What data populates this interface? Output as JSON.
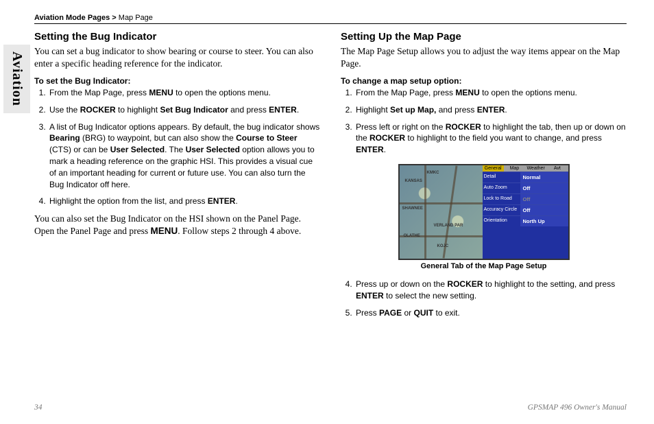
{
  "tab": "Aviation",
  "breadcrumb": {
    "category": "Aviation Mode Pages >",
    "page": " Map Page"
  },
  "left": {
    "heading": "Setting the Bug Indicator",
    "intro": "You can set a bug indicator to show bearing or course to steer. You can also enter a specific heading reference for the indicator.",
    "subhead": "To set the Bug Indicator:",
    "steps": [
      "From the Map Page, press <b class='k'>MENU</b> to open the options menu.",
      "Use the <b class='k'>ROCKER</b> to highlight <b class='k'>Set Bug Indicator</b> and press <b class='k'>ENTER</b>.",
      "A list of Bug Indicator options appears. By default, the bug indicator shows <b class='k'>Bearing</b> (BRG) to waypoint, but can also show the <b class='k'>Course to Steer</b> (CTS) or can be <b class='k'>User Selected</b>. The <b class='k'>User Selected</b> option allows you to mark a heading reference on the graphic HSI. This provides a visual cue of an important heading for current or future use. You can also turn the Bug Indicator off here.",
      "Highlight the option from the list, and press <b class='k'>ENTER</b>."
    ],
    "followup": "You can also set the Bug Indicator on the HSI shown on the Panel Page. Open the Panel Page and press <b class='k'>MENU</b>. Follow steps 2 through 4 above."
  },
  "right": {
    "heading": "Setting Up the Map Page",
    "intro": "The Map Page Setup allows you to adjust the way items appear on the Map Page.",
    "subhead": "To change a map setup option:",
    "steps_a": [
      "From the Map Page, press <b class='k'>MENU</b> to open the options menu.",
      "Highlight <b class='k'>Set up Map,</b> and press <b class='k'>ENTER</b>.",
      "Press left or right on the <b class='k'>ROCKER</b> to highlight the tab, then up or down on the <b class='k'>ROCKER</b> to highlight to the field you want to change, and press <b class='k'>ENTER</b>."
    ],
    "steps_b": [
      "Press up or down on the <b class='k'>ROCKER</b> to highlight to the setting, and press <b class='k'>ENTER</b> to select the new setting.",
      "Press <b class='k'>PAGE</b> or <b class='k'>QUIT</b> to exit."
    ],
    "figure": {
      "caption": "General Tab of the Map Page Setup",
      "tabs": [
        "General",
        "Map",
        "Weather",
        "Avt"
      ],
      "rows": [
        {
          "key": "Detail",
          "val": "Normal"
        },
        {
          "key": "Auto Zoom",
          "val": "Off"
        },
        {
          "key": "Lock to Road",
          "val": "Off",
          "dim": true
        },
        {
          "key": "Accuracy Circle",
          "val": "Off"
        },
        {
          "key": "Orientation",
          "val": "North Up"
        }
      ],
      "map_labels": [
        "KMKC",
        "KANSAS",
        "SHAWNEE",
        "OLATHE",
        "KOJC",
        "VERLAND PAR"
      ]
    }
  },
  "footer": {
    "page": "34",
    "manual": "GPSMAP 496 Owner's Manual"
  }
}
